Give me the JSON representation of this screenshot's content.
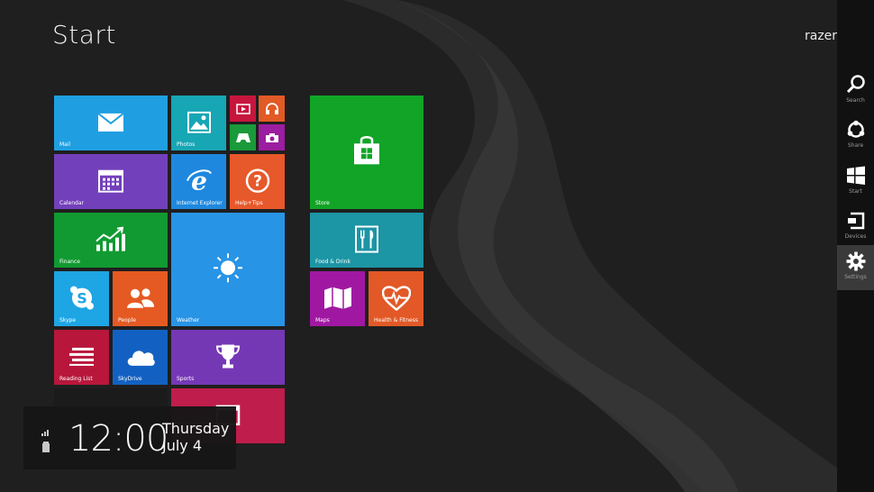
{
  "screen": {
    "title": "Start",
    "user": "razer"
  },
  "tiles": [
    {
      "label": "Mail",
      "color": "#1f9fe1",
      "icon": "mail-icon"
    },
    {
      "label": "Photos",
      "color": "#17a6b4",
      "icon": "photos-icon"
    },
    {
      "label": "",
      "color": "#c7163e",
      "icon": "video-icon"
    },
    {
      "label": "",
      "color": "#e25a25",
      "icon": "headphones-icon"
    },
    {
      "label": "",
      "color": "#1a9a3a",
      "icon": "games-icon"
    },
    {
      "label": "",
      "color": "#9c1da0",
      "icon": "camera-icon"
    },
    {
      "label": "Calendar",
      "color": "#7340bb",
      "icon": "calendar-icon"
    },
    {
      "label": "Internet Explorer",
      "color": "#1e88df",
      "icon": "internet-explorer-icon"
    },
    {
      "label": "Help+Tips",
      "color": "#e7582a",
      "icon": "help-icon"
    },
    {
      "label": "Finance",
      "color": "#119a31",
      "icon": "finance-icon"
    },
    {
      "label": "Weather",
      "color": "#2894e6",
      "icon": "weather-sun-icon"
    },
    {
      "label": "Skype",
      "color": "#1ea5e3",
      "icon": "skype-icon"
    },
    {
      "label": "People",
      "color": "#e55a23",
      "icon": "people-icon"
    },
    {
      "label": "Reading List",
      "color": "#b8173b",
      "icon": "reading-list-icon"
    },
    {
      "label": "SkyDrive",
      "color": "#1261c2",
      "icon": "skydrive-icon"
    },
    {
      "label": "Sports",
      "color": "#7538b5",
      "icon": "trophy-icon"
    },
    {
      "label": "",
      "color": "#1b1b1b",
      "icon": "desktop-icon"
    },
    {
      "label": "",
      "color": "#bf1d4b",
      "icon": "app-icon"
    },
    {
      "label": "Store",
      "color": "#11a426",
      "icon": "store-icon"
    },
    {
      "label": "Food & Drink",
      "color": "#1c95a4",
      "icon": "food-drink-icon"
    },
    {
      "label": "Maps",
      "color": "#a018a2",
      "icon": "maps-icon"
    },
    {
      "label": "Health & Fitness",
      "color": "#e25927",
      "icon": "health-fitness-icon"
    }
  ],
  "charms": [
    {
      "label": "Search",
      "icon": "search-icon"
    },
    {
      "label": "Share",
      "icon": "share-icon"
    },
    {
      "label": "Start",
      "icon": "windows-start-icon"
    },
    {
      "label": "Devices",
      "icon": "devices-icon"
    },
    {
      "label": "Settings",
      "icon": "settings-gear-icon"
    }
  ],
  "clock": {
    "time": "12:00",
    "day": "Thursday",
    "date": "July 4"
  }
}
